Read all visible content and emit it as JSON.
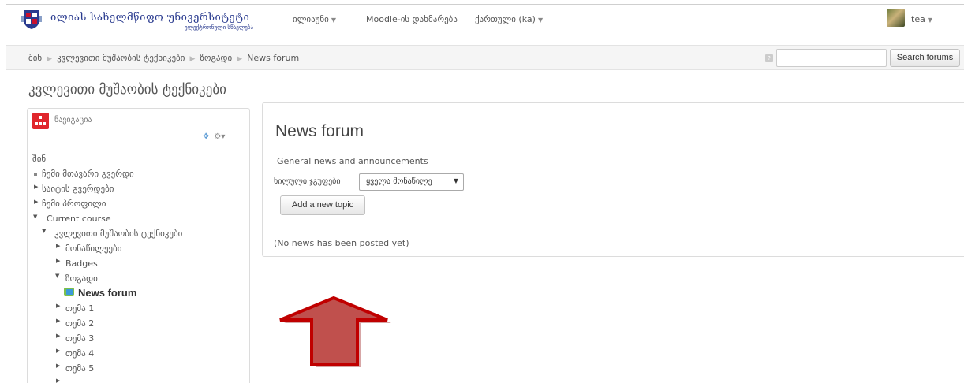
{
  "header": {
    "logo_title": "ილიას სახელმწიფო უნივერსიტეტი",
    "logo_subtitle": "ელექტრონული სწავლება",
    "menu": [
      {
        "label": "ილიაუნი",
        "has_caret": true
      },
      {
        "label": "Moodle-ის დახმარება",
        "has_caret": false
      },
      {
        "label": "ქართული (ka)",
        "has_caret": true
      }
    ],
    "user_name": "tea"
  },
  "breadcrumb": [
    "შინ",
    "კვლევითი მუშაობის ტექნიკები",
    "ზოგადი",
    "News forum"
  ],
  "search": {
    "placeholder": "",
    "button_label": "Search forums"
  },
  "page_heading": "კვლევითი მუშაობის ტექნიკები",
  "nav_block": {
    "title": "ნავიგაცია",
    "items": [
      {
        "label": "შინ",
        "level": 0,
        "marker": "none"
      },
      {
        "label": "ჩემი მთავარი გვერდი",
        "level": 0,
        "marker": "square"
      },
      {
        "label": "საიტის გვერდები",
        "level": 0,
        "marker": "collapsed"
      },
      {
        "label": "ჩემი პროფილი",
        "level": 0,
        "marker": "collapsed"
      },
      {
        "label": "Current course",
        "level": 0,
        "marker": "expanded"
      },
      {
        "label": "კვლევითი მუშაობის ტექნიკები",
        "level": 1,
        "marker": "expanded"
      },
      {
        "label": "მონაწილეები",
        "level": 2,
        "marker": "collapsed"
      },
      {
        "label": "Badges",
        "level": 2,
        "marker": "collapsed"
      },
      {
        "label": "ზოგადი",
        "level": 2,
        "marker": "expanded"
      },
      {
        "label": "News forum",
        "level": 3,
        "marker": "forum",
        "active": true
      },
      {
        "label": "თემა 1",
        "level": 2,
        "marker": "collapsed"
      },
      {
        "label": "თემა 2",
        "level": 2,
        "marker": "collapsed"
      },
      {
        "label": "თემა 3",
        "level": 2,
        "marker": "collapsed"
      },
      {
        "label": "თემა 4",
        "level": 2,
        "marker": "collapsed"
      },
      {
        "label": "თემა 5",
        "level": 2,
        "marker": "collapsed"
      }
    ]
  },
  "main": {
    "title": "News forum",
    "description": "General news and announcements",
    "groups_label": "ხილული ჯგუფები",
    "groups_selected": "ყველა მონაწილე",
    "add_topic_label": "Add a new topic",
    "empty_message": "(No news has been posted yet)"
  },
  "colors": {
    "arrow_fill": "#c0504d",
    "arrow_border": "#c00000",
    "nav_icon": "#e0262c"
  }
}
